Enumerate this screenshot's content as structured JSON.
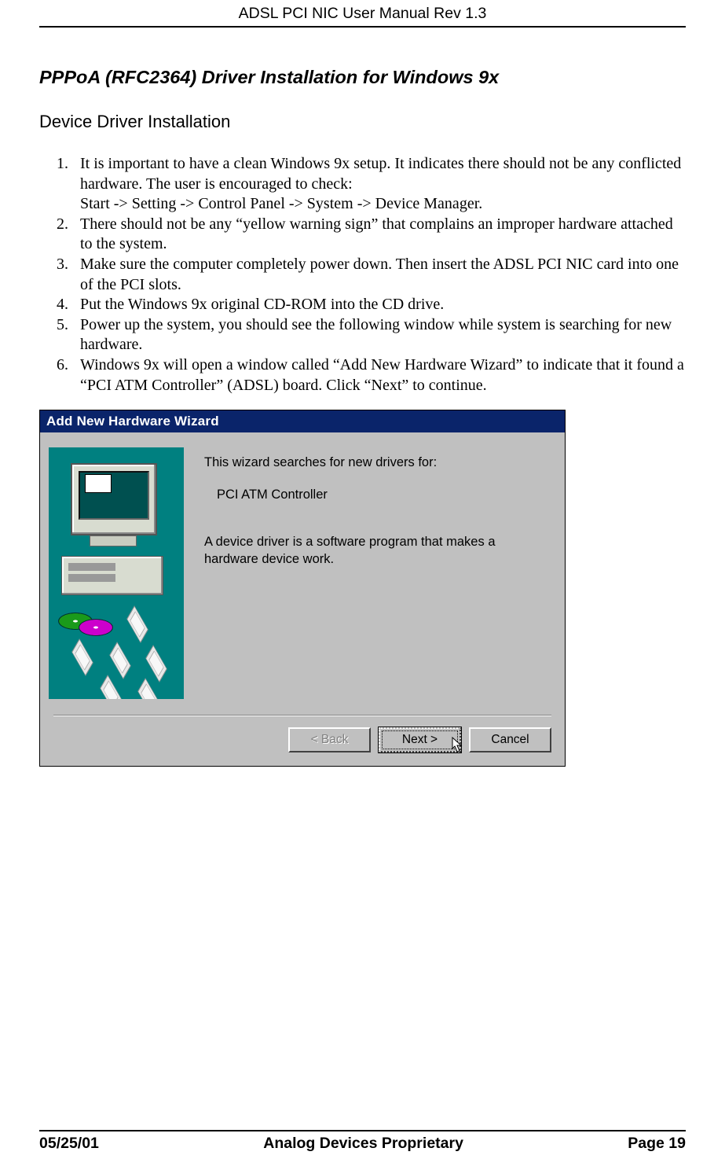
{
  "header": {
    "title": "ADSL PCI NIC User Manual Rev 1.3"
  },
  "section": {
    "title": "PPPoA (RFC2364) Driver Installation for Windows 9x"
  },
  "subsection": {
    "title": "Device Driver Installation"
  },
  "steps": [
    "It is important to have a clean Windows 9x setup.  It indicates there should not be any conflicted hardware.  The user is encouraged to check:\nStart -> Setting -> Control Panel -> System -> Device Manager.",
    "There should not be any “yellow warning sign” that complains an improper hardware attached to the system.",
    "Make sure the computer completely power down.  Then insert the ADSL PCI NIC card into one of the PCI slots.",
    "Put the Windows 9x original CD-ROM into the CD drive.",
    "Power up the system, you should see the following window while system is searching for new hardware.",
    "Windows 9x will open a window called “Add New Hardware Wizard” to indicate that it found a “PCI ATM Controller” (ADSL) board.  Click “Next” to continue."
  ],
  "dialog": {
    "title": "Add New Hardware Wizard",
    "line1": "This wizard searches for new drivers for:",
    "device": "PCI ATM Controller",
    "description": "A device driver is a software program that makes a hardware device work.",
    "buttons": {
      "back": "< Back",
      "next": "Next >",
      "cancel": "Cancel"
    }
  },
  "footer": {
    "date": "05/25/01",
    "center": "Analog Devices Proprietary",
    "page": "Page 19"
  }
}
